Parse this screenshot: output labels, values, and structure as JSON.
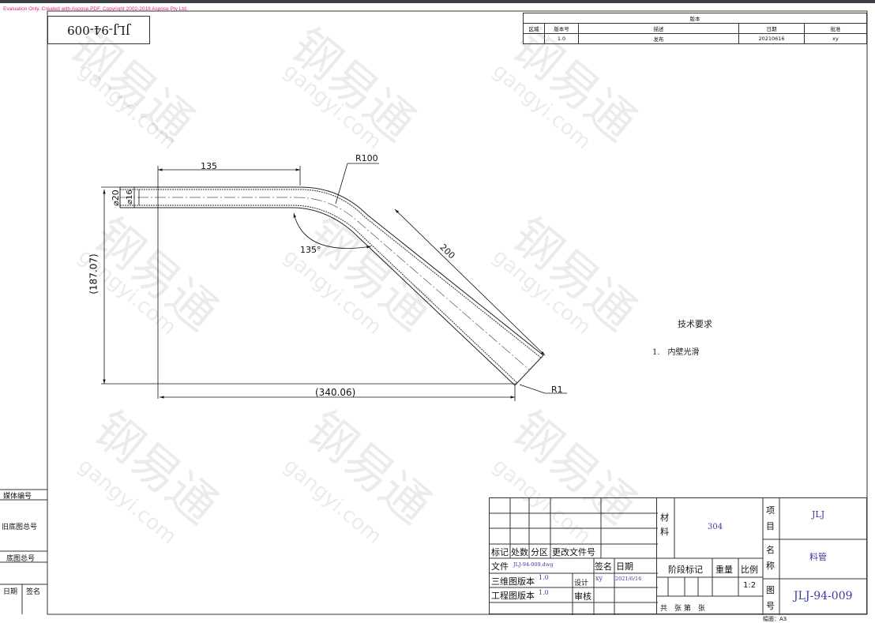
{
  "eval_notice": "Evaluation Only. Created with Aspose.PDF. Copyright 2002-2018 Aspose Pty Ltd.",
  "drawing_no_rotated": "JLJ-94-009",
  "revision": {
    "title": "版本",
    "headers": [
      "区域",
      "版本号",
      "描述",
      "日期",
      "批准"
    ],
    "row": [
      "",
      "1.0",
      "发布",
      "20210616",
      "xy"
    ]
  },
  "dimensions": {
    "d1": "135",
    "d2": "R100",
    "d3": "200",
    "d4": "135°",
    "d5": "R1",
    "d6": "(340.06)",
    "d7": "(187.07)",
    "d8": "⌀20",
    "d9": "⌀16"
  },
  "notes": {
    "title": "技术要求",
    "item1": "1.　内壁光滑"
  },
  "left_labels": [
    "媒体编号",
    "旧底图总号",
    "底图总号",
    "日期",
    "签名"
  ],
  "title_block": {
    "h_mark": "标记",
    "h_count": "处数",
    "h_zone": "分区",
    "h_change": "更改文件号",
    "file_label": "文件",
    "file_value": "JLJ-94-009.dwg",
    "sign_label": "签名",
    "date_label": "日期",
    "model_label": "三维图版本",
    "model_value": "1.0",
    "drawing_label": "工程图版本",
    "drawing_value": "1.0",
    "designer_label": "设计",
    "designer": "xy",
    "design_date": "2021/6/16",
    "review_label": "审核",
    "material_label": "材料",
    "material": "304",
    "project_label": "项目",
    "project": "JLJ",
    "name_label": "名称",
    "name": "料管",
    "drawing_no_label": "图号",
    "drawing_no": "JLJ-94-009",
    "stage_label": "阶段标记",
    "weight_label": "重量",
    "scale_label": "比例",
    "scale": "1:2",
    "sheets_text": "共　张 第　张",
    "format": "幅面：A3"
  },
  "watermark": {
    "logo": "钢易通",
    "url": "gangyi.com"
  }
}
